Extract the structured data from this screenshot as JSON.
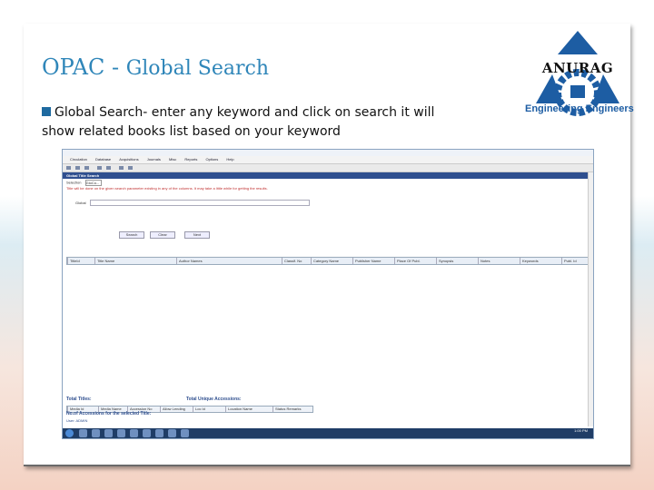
{
  "slide": {
    "title_main": "OPAC - ",
    "title_sub": "Global Search",
    "bullet_line1": "Global Search- enter any keyword and click on search it will",
    "bullet_line2": "show related books list based on your keyword"
  },
  "logo": {
    "name": "ANURAG",
    "tagline": "Engineering Engineers"
  },
  "colors": {
    "title": "#2f86b9",
    "logo_blue": "#1d5da3",
    "panel_header": "#2f4f8f"
  },
  "app": {
    "menu": [
      "Circulation",
      "Database",
      "Acquisitions",
      "Journals",
      "Misc",
      "Reports",
      "Options",
      "Help"
    ],
    "panel_title": "Global Title Search",
    "selection_label": "Selection",
    "selection_value": "GloCo...",
    "hint": "Title will be done on the given search parameter existing in any of the columns. It may take a little while for getting the results.",
    "global_label": "Global",
    "buttons": {
      "search": "Search",
      "clear": "Clear",
      "next": "Next"
    },
    "grid_columns": [
      "TitleId",
      "Title Name",
      "Author Names",
      "Classif. No",
      "Category Name",
      "Publisher Name",
      "Place Of Publ.",
      "Synopsis",
      "Notes",
      "Keywords",
      "Publ. Id"
    ],
    "total_titles": "Total Titles:",
    "total_accessions": "Total Unique Accessions:",
    "accession_columns": [
      "Media Id",
      "Media Name",
      "Accession No",
      "Allow Lending",
      "Loc Id",
      "Location Name",
      "Status Remarks"
    ],
    "accessions_label": "No.of Accessions for the selected Title:",
    "status": "User: ADMIN",
    "clock": "1:00 PM"
  }
}
